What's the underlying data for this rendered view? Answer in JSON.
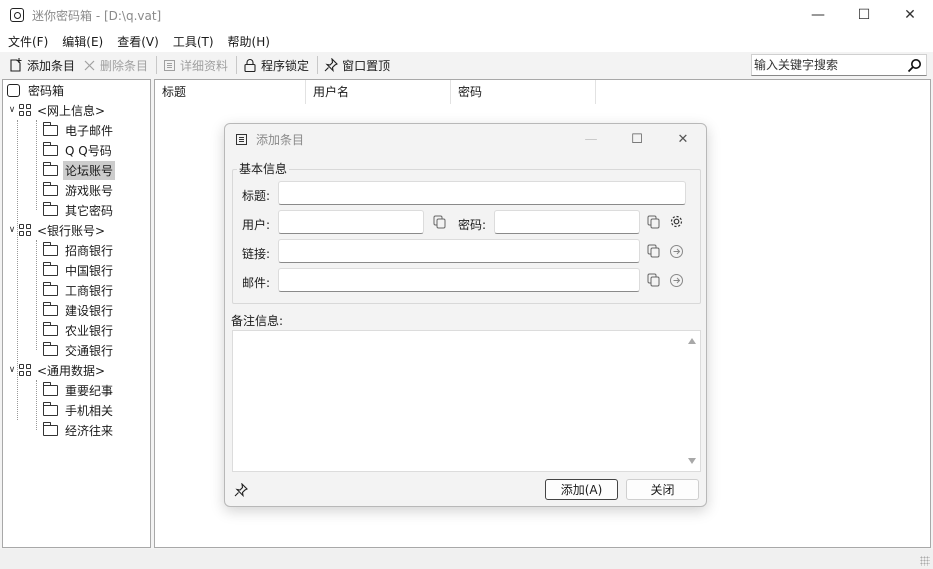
{
  "window": {
    "title": "迷你密码箱 - [D:\\q.vat]"
  },
  "menu": [
    "文件(F)",
    "编辑(E)",
    "查看(V)",
    "工具(T)",
    "帮助(H)"
  ],
  "toolbar": {
    "add": "添加条目",
    "delete": "删除条目",
    "details": "详细资料",
    "lock": "程序锁定",
    "pin": "窗口置顶",
    "search_placeholder": "输入关键字搜索"
  },
  "tree": {
    "root": "密码箱",
    "groups": [
      {
        "label": "<网上信息>",
        "items": [
          "电子邮件",
          "Q Q号码",
          "论坛账号",
          "游戏账号",
          "其它密码"
        ]
      },
      {
        "label": "<银行账号>",
        "items": [
          "招商银行",
          "中国银行",
          "工商银行",
          "建设银行",
          "农业银行",
          "交通银行"
        ]
      },
      {
        "label": "<通用数据>",
        "items": [
          "重要纪事",
          "手机相关",
          "经济往来"
        ]
      }
    ],
    "selected": "论坛账号"
  },
  "list": {
    "columns": [
      "标题",
      "用户名",
      "密码"
    ]
  },
  "dialog": {
    "title": "添加条目",
    "group_title": "基本信息",
    "labels": {
      "title": "标题:",
      "user": "用户:",
      "password": "密码:",
      "link": "链接:",
      "email": "邮件:",
      "notes": "备注信息:"
    },
    "buttons": {
      "add": "添加(A)",
      "close": "关闭"
    }
  }
}
